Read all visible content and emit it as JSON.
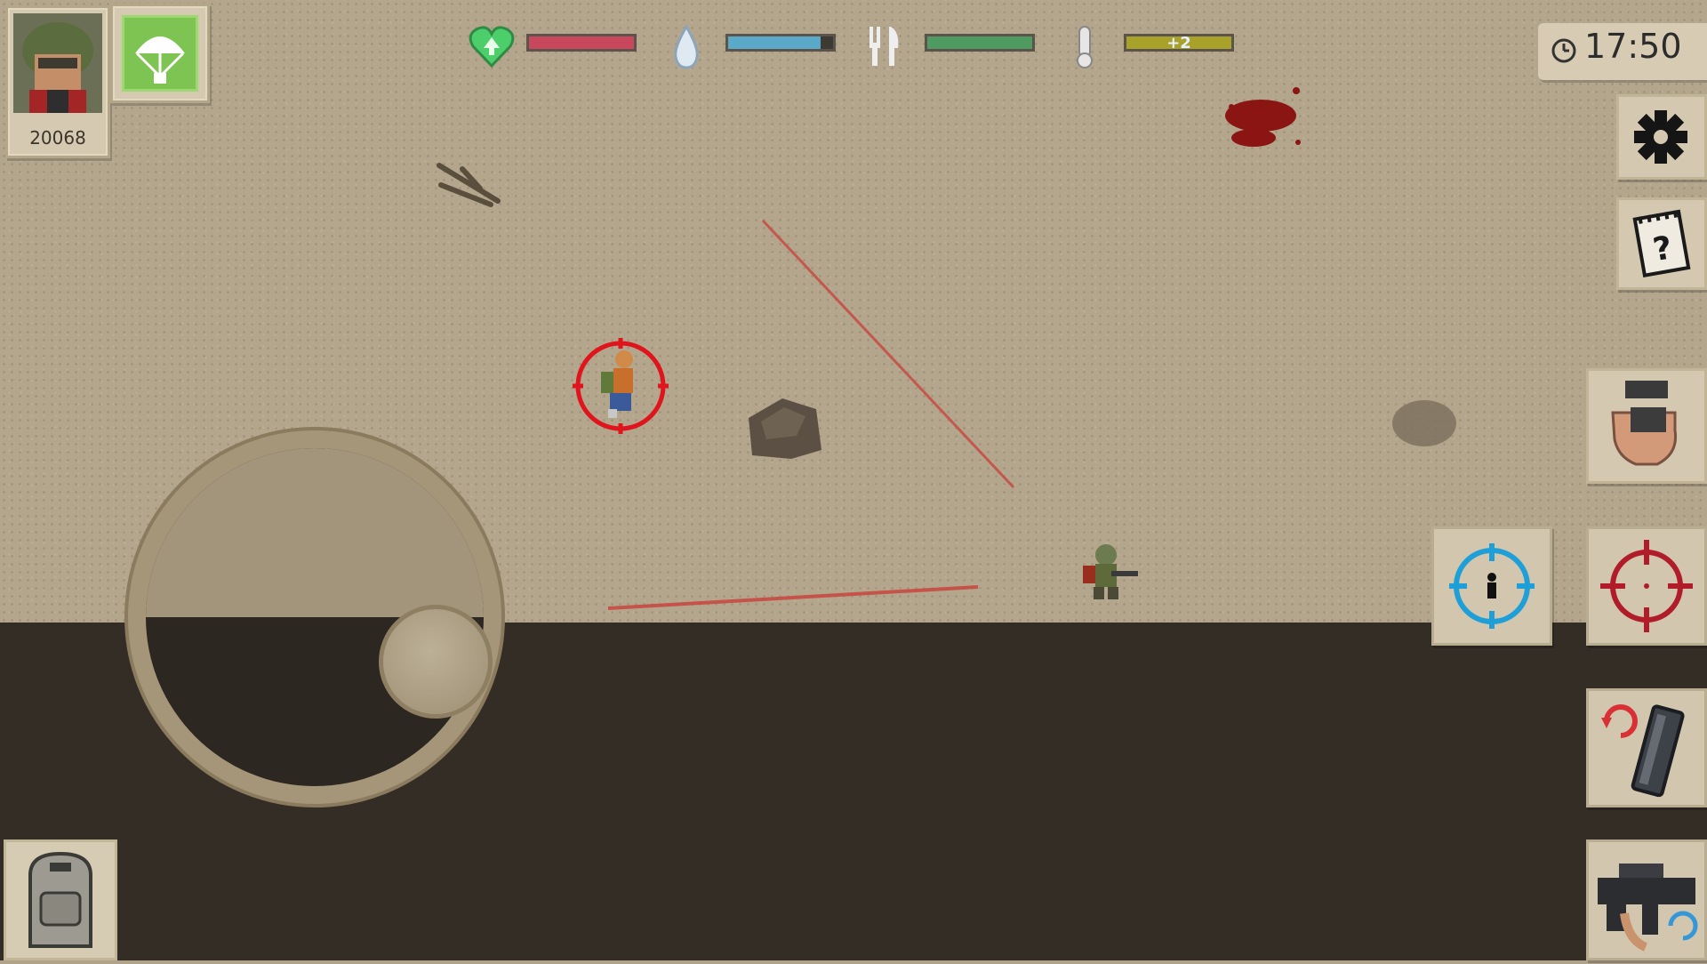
{
  "hud": {
    "player_score": "20068",
    "clock_time": "17:50",
    "status": {
      "health": {
        "icon": "heart-icon",
        "level": 1.0,
        "color": "#c8475a"
      },
      "thirst": {
        "icon": "water-drop-icon",
        "level": 0.88,
        "color": "#5aa9c8"
      },
      "hunger": {
        "icon": "fork-knife-icon",
        "level": 1.0,
        "color": "#4f9a60"
      },
      "temperature": {
        "icon": "thermometer-icon",
        "level": 1.0,
        "color": "#a8a22a",
        "label": "+2"
      }
    }
  },
  "buttons": {
    "airdrop": {
      "icon": "parachute-icon"
    },
    "settings": {
      "icon": "gear-icon"
    },
    "quests": {
      "icon": "notepad-question-icon"
    },
    "interact": {
      "icon": "hand-icon"
    },
    "target_ally": {
      "icon": "crosshair-person-icon"
    },
    "target_enemy": {
      "icon": "crosshair-icon"
    },
    "reload": {
      "icon": "reload-magazine-icon"
    },
    "weapon": {
      "icon": "rifle-swap-icon"
    },
    "backpack": {
      "icon": "backpack-icon"
    },
    "joystick": {
      "icon": "joystick-icon"
    }
  },
  "colors": {
    "ground": "#b3a68d",
    "void": "#342d25",
    "target_red": "#e0141c",
    "aim_blue": "#1f9fd8"
  }
}
